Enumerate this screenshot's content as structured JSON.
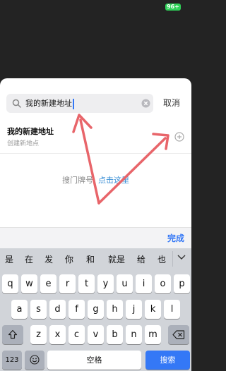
{
  "status_bar": {
    "battery": "96+"
  },
  "search": {
    "value": "我的新建地址",
    "cancel_label": "取消"
  },
  "result": {
    "title": "我的新建地址",
    "subtitle": "创建新地点"
  },
  "hint": {
    "text": "搜门牌号,",
    "link": "点击这里"
  },
  "accessory": {
    "done_label": "完成"
  },
  "keyboard": {
    "candidates": [
      "是",
      "在",
      "发",
      "你",
      "和",
      "就是",
      "给",
      "也"
    ],
    "row1": [
      "q",
      "w",
      "e",
      "r",
      "t",
      "y",
      "u",
      "i",
      "o",
      "p"
    ],
    "row2": [
      "a",
      "s",
      "d",
      "f",
      "g",
      "h",
      "j",
      "k",
      "l"
    ],
    "row3": [
      "z",
      "x",
      "c",
      "v",
      "b",
      "n",
      "m"
    ],
    "numbers_label": "123",
    "space_label": "空格",
    "search_label": "搜索"
  },
  "colors": {
    "accent": "#3478f6",
    "link": "#3a8fd6",
    "annotation_arrow": "#e8656a",
    "battery": "#2fd158"
  }
}
